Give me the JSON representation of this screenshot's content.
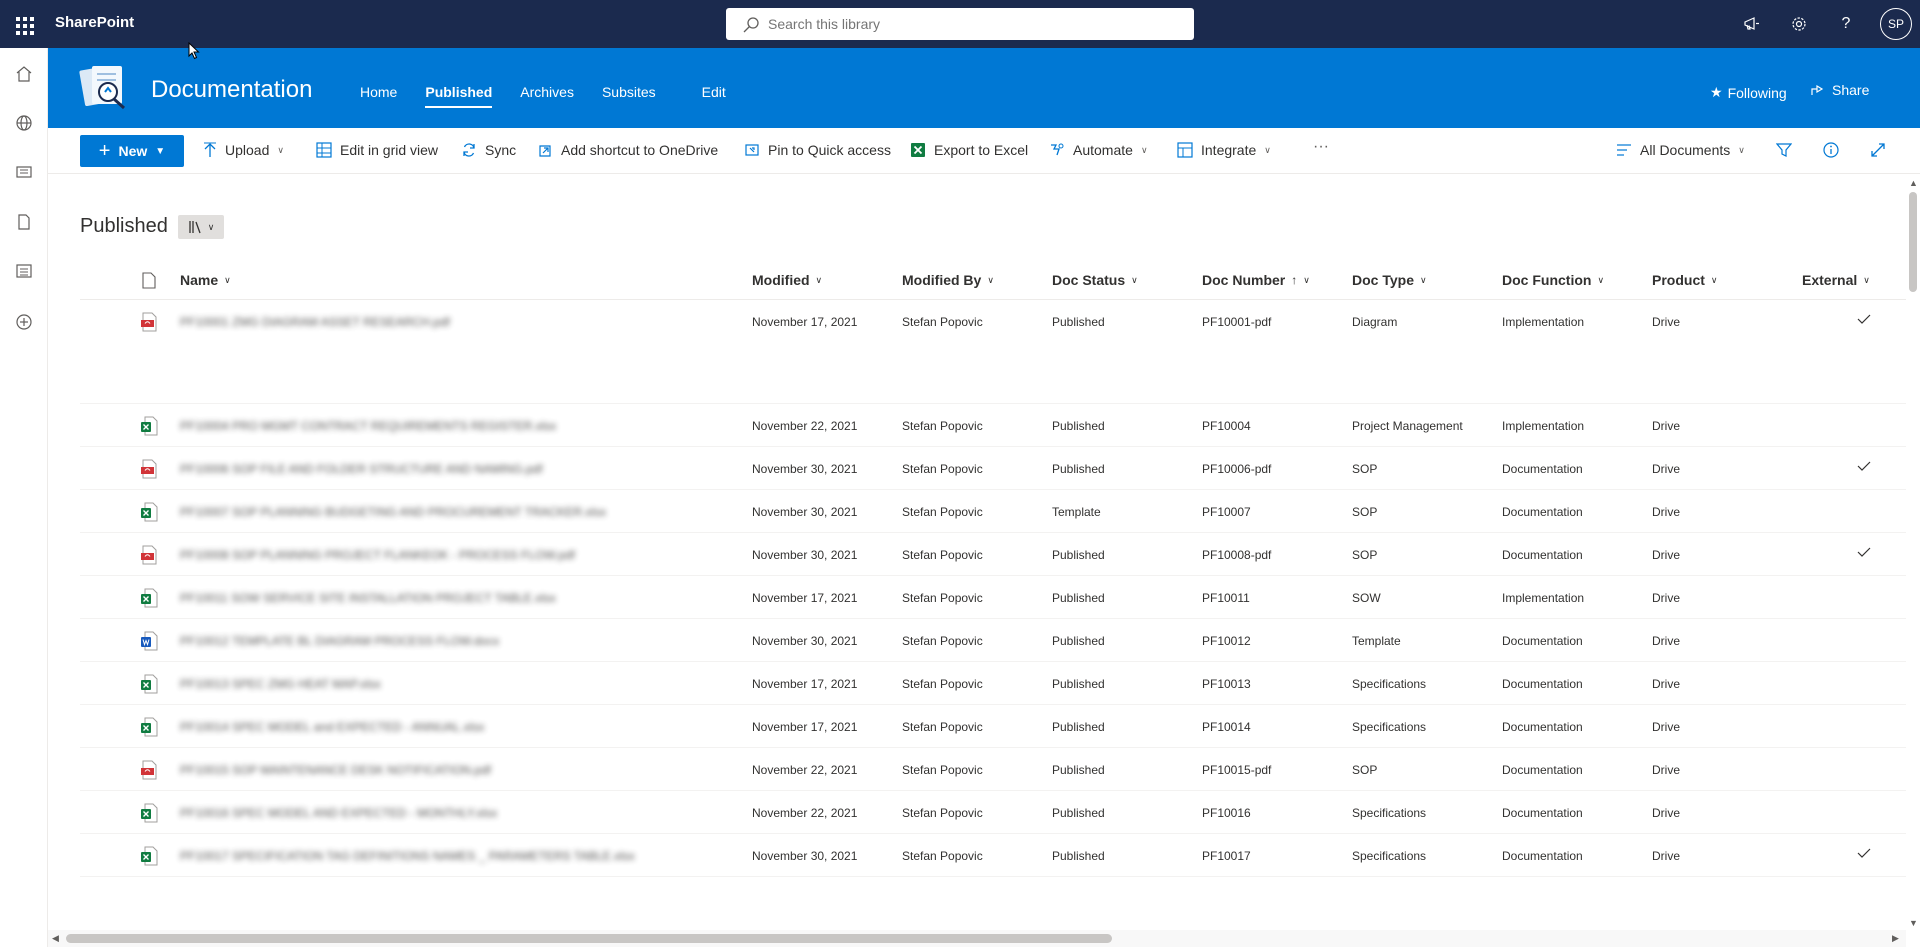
{
  "suite": {
    "app_name": "SharePoint",
    "search_placeholder": "Search this library",
    "avatar_initials": "SP"
  },
  "site": {
    "title": "Documentation",
    "nav": [
      "Home",
      "Published",
      "Archives",
      "Subsites",
      "Edit"
    ],
    "active_nav": "Published",
    "following_label": "Following",
    "share_label": "Share"
  },
  "command_bar": {
    "new_label": "New",
    "upload_label": "Upload",
    "grid_label": "Edit in grid view",
    "sync_label": "Sync",
    "shortcut_label": "Add shortcut to OneDrive",
    "pin_label": "Pin to Quick access",
    "export_label": "Export to Excel",
    "automate_label": "Automate",
    "integrate_label": "Integrate",
    "more_label": "···",
    "view_label": "All Documents"
  },
  "library": {
    "title": "Published",
    "columns": {
      "name": "Name",
      "modified": "Modified",
      "modified_by": "Modified By",
      "doc_status": "Doc Status",
      "doc_number": "Doc Number",
      "doc_type": "Doc Type",
      "doc_function": "Doc Function",
      "product": "Product",
      "external": "External"
    },
    "rows": [
      {
        "file_type": "pdf",
        "name": "PF10001 ZMG DIAGRAM ASSET RESEARCH.pdf",
        "modified": "November 17, 2021",
        "modified_by": "Stefan Popovic",
        "status": "Published",
        "number": "PF10001-pdf",
        "type": "Diagram",
        "function": "Implementation",
        "product": "Drive",
        "external": true
      },
      {
        "file_type": "xlsx",
        "name": "PF10004 PRO MGMT CONTRACT REQUIREMENTS REGISTER.xlsx",
        "modified": "November 22, 2021",
        "modified_by": "Stefan Popovic",
        "status": "Published",
        "number": "PF10004",
        "type": "Project Management",
        "function": "Implementation",
        "product": "Drive",
        "external": false
      },
      {
        "file_type": "pdf",
        "name": "PF10006 SOP FILE AND FOLDER STRUCTURE AND NAMING.pdf",
        "modified": "November 30, 2021",
        "modified_by": "Stefan Popovic",
        "status": "Published",
        "number": "PF10006-pdf",
        "type": "SOP",
        "function": "Documentation",
        "product": "Drive",
        "external": true
      },
      {
        "file_type": "xlsx",
        "name": "PF10007 SOP PLANNING BUDGETING AND PROCUREMENT TRACKER.xlsx",
        "modified": "November 30, 2021",
        "modified_by": "Stefan Popovic",
        "status": "Template",
        "number": "PF10007",
        "type": "SOP",
        "function": "Documentation",
        "product": "Drive",
        "external": false
      },
      {
        "file_type": "pdf",
        "name": "PF10008 SOP PLANNING PROJECT FLANKEOK - PROCESS FLOW.pdf",
        "modified": "November 30, 2021",
        "modified_by": "Stefan Popovic",
        "status": "Published",
        "number": "PF10008-pdf",
        "type": "SOP",
        "function": "Documentation",
        "product": "Drive",
        "external": true
      },
      {
        "file_type": "xlsx",
        "name": "PF10011 SOW SERVICE SITE INSTALLATION PROJECT TABLE.xlsx",
        "modified": "November 17, 2021",
        "modified_by": "Stefan Popovic",
        "status": "Published",
        "number": "PF10011",
        "type": "SOW",
        "function": "Implementation",
        "product": "Drive",
        "external": false
      },
      {
        "file_type": "docx",
        "name": "PF10012 TEMPLATE BL DIAGRAM PROCESS FLOW.docx",
        "modified": "November 30, 2021",
        "modified_by": "Stefan Popovic",
        "status": "Published",
        "number": "PF10012",
        "type": "Template",
        "function": "Documentation",
        "product": "Drive",
        "external": false
      },
      {
        "file_type": "xlsx",
        "name": "PF10013 SPEC ZMG HEAT MAP.xlsx",
        "modified": "November 17, 2021",
        "modified_by": "Stefan Popovic",
        "status": "Published",
        "number": "PF10013",
        "type": "Specifications",
        "function": "Documentation",
        "product": "Drive",
        "external": false
      },
      {
        "file_type": "xlsx",
        "name": "PF10014 SPEC MODEL and EXPECTED - ANNUAL.xlsx",
        "modified": "November 17, 2021",
        "modified_by": "Stefan Popovic",
        "status": "Published",
        "number": "PF10014",
        "type": "Specifications",
        "function": "Documentation",
        "product": "Drive",
        "external": false
      },
      {
        "file_type": "pdf",
        "name": "PF10015 SOP MAINTENANCE DESK NOTIFICATION.pdf",
        "modified": "November 22, 2021",
        "modified_by": "Stefan Popovic",
        "status": "Published",
        "number": "PF10015-pdf",
        "type": "SOP",
        "function": "Documentation",
        "product": "Drive",
        "external": false
      },
      {
        "file_type": "xlsx",
        "name": "PF10016 SPEC MODEL AND EXPECTED - MONTHLY.xlsx",
        "modified": "November 22, 2021",
        "modified_by": "Stefan Popovic",
        "status": "Published",
        "number": "PF10016",
        "type": "Specifications",
        "function": "Documentation",
        "product": "Drive",
        "external": false
      },
      {
        "file_type": "xlsx",
        "name": "PF10017 SPECIFICATION TAG DEFINITIONS NAMES _ PARAMETERS TABLE.xlsx",
        "modified": "November 30, 2021",
        "modified_by": "Stefan Popovic",
        "status": "Published",
        "number": "PF10017",
        "type": "Specifications",
        "function": "Documentation",
        "product": "Drive",
        "external": true
      }
    ]
  },
  "colors": {
    "suite_bar": "#1b2a4e",
    "theme": "#0078d4",
    "pdf": "#d13438",
    "excel": "#107c41",
    "word": "#185abd"
  }
}
